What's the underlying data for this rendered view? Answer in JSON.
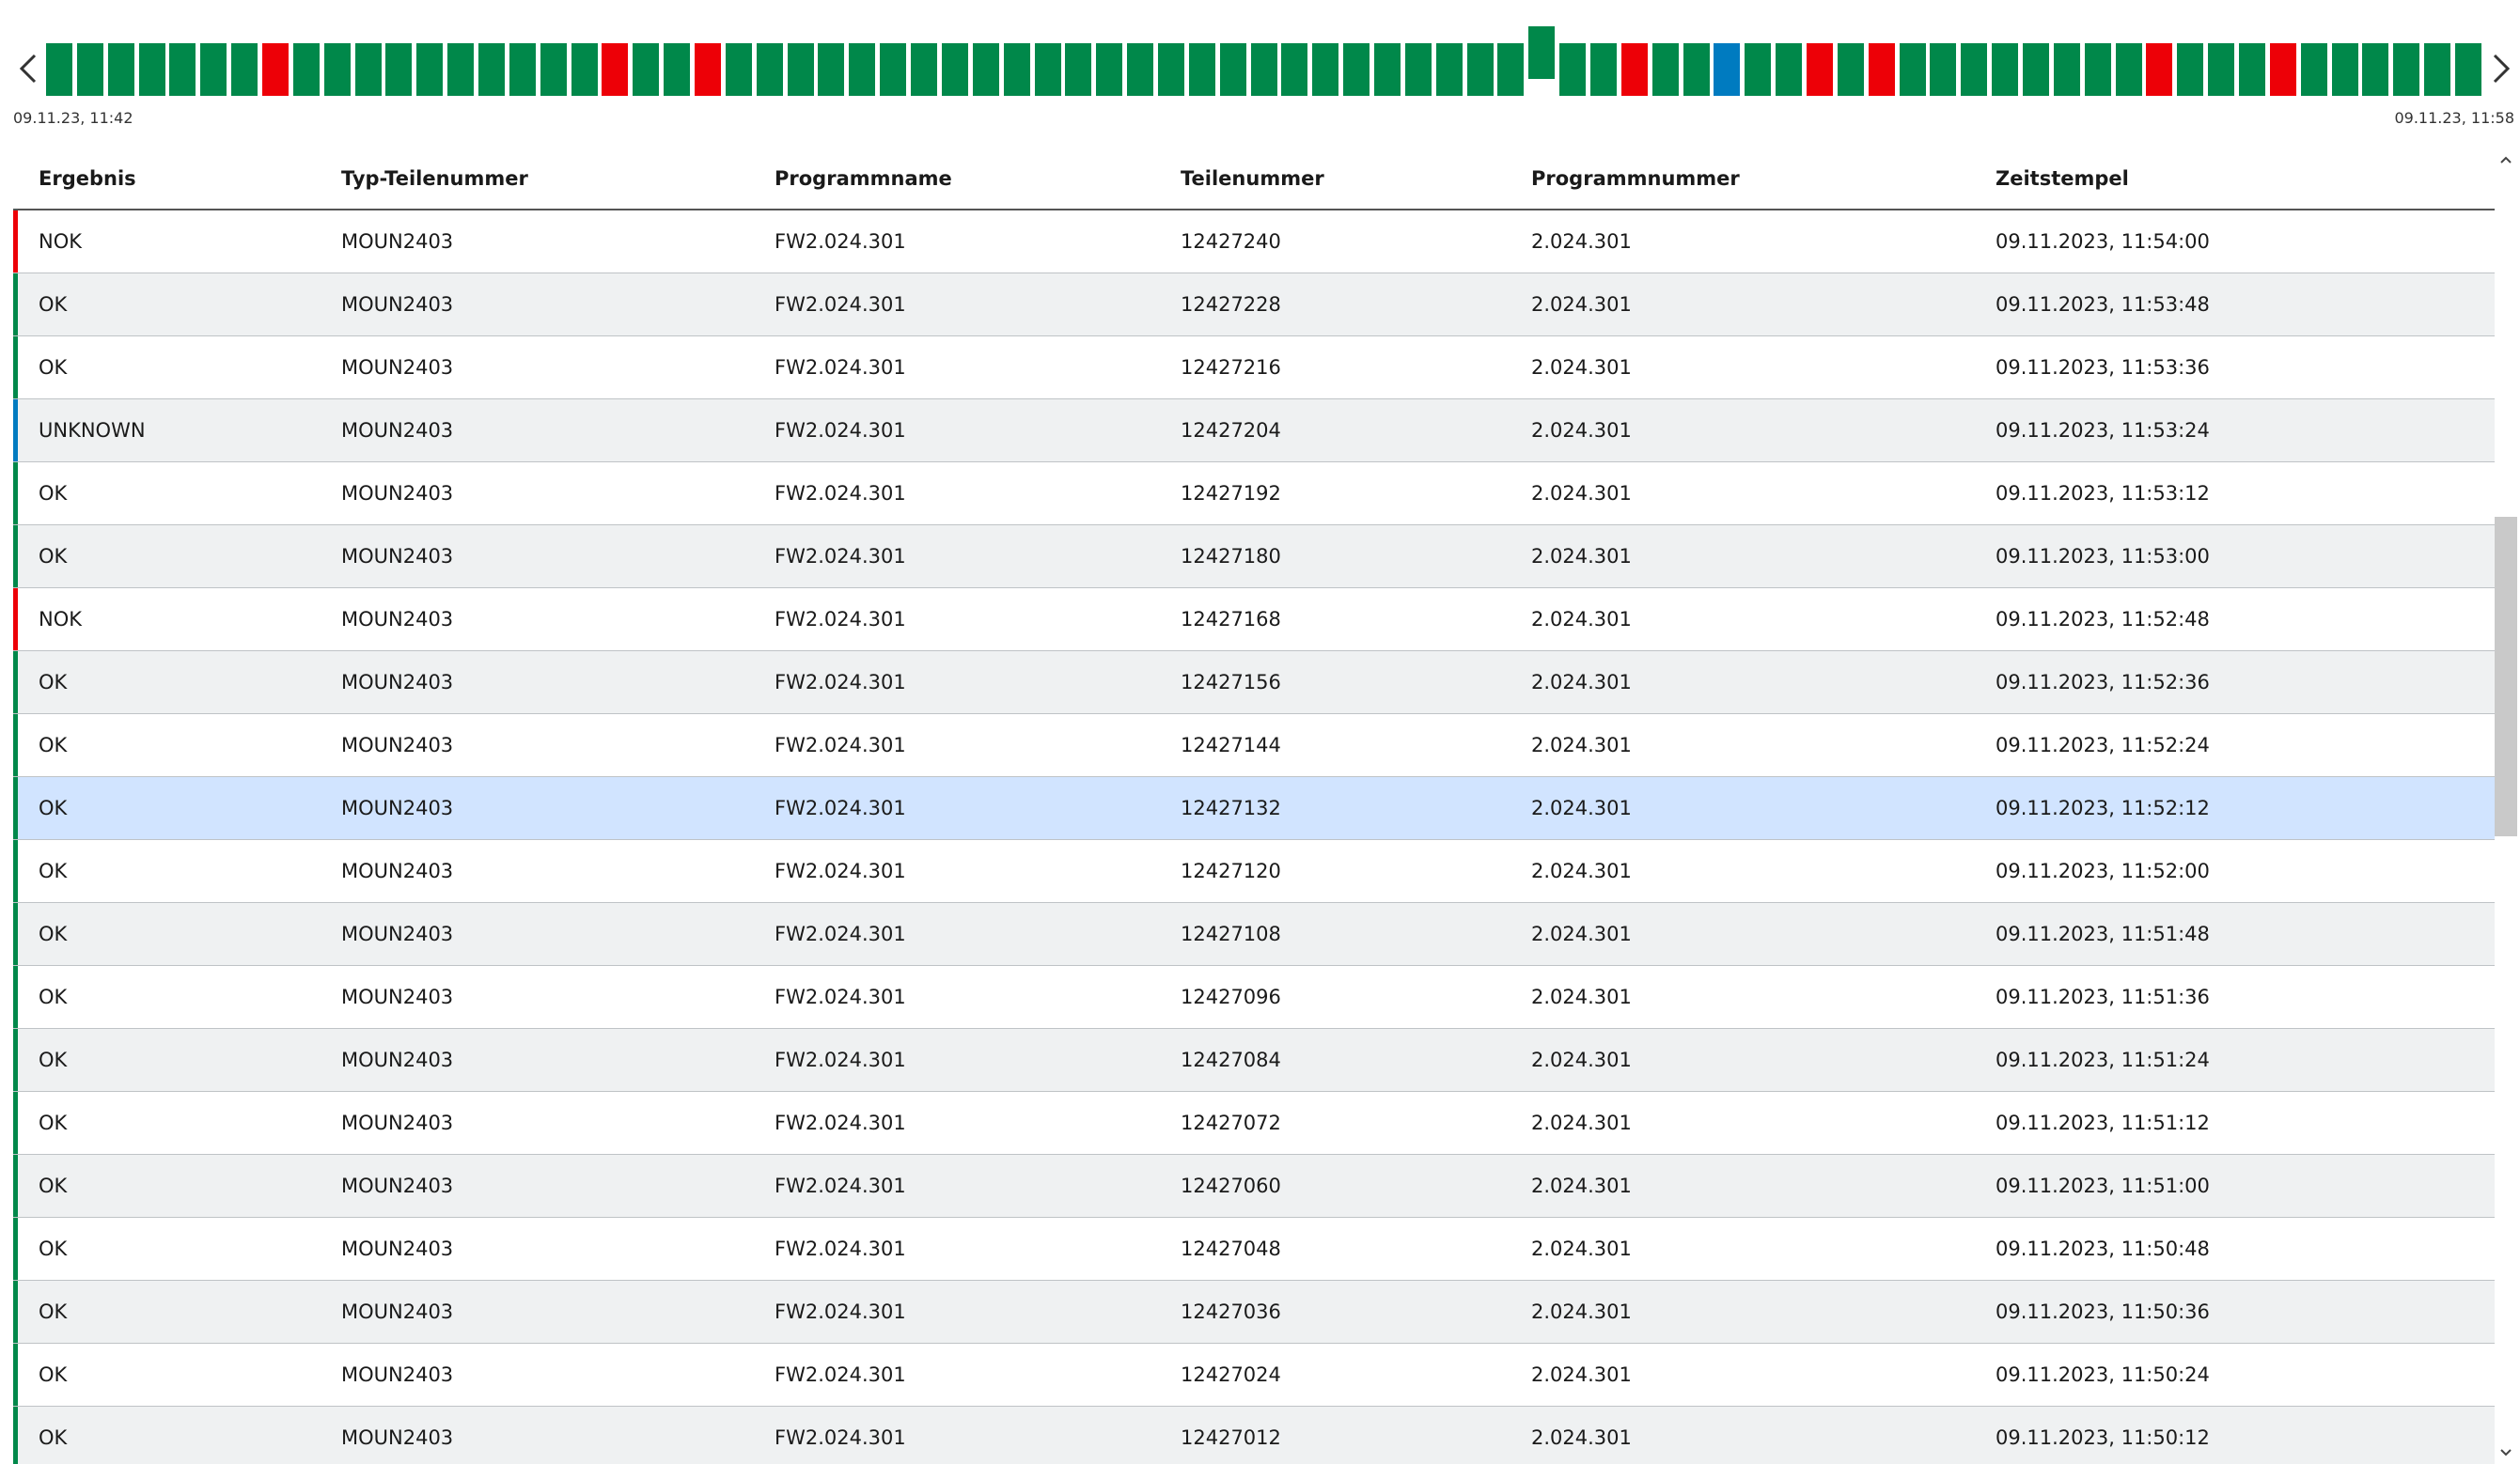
{
  "timeline": {
    "start_time": "09.11.23, 11:42",
    "end_time": "09.11.23, 11:58",
    "prev_icon": "chevron-left-icon",
    "next_icon": "chevron-right-icon",
    "colors": {
      "OK": "#00884a",
      "NOK": "#ed0007",
      "UNKNOWN": "#007bc0"
    },
    "selected_index": 48,
    "bars": [
      "OK",
      "OK",
      "OK",
      "OK",
      "OK",
      "OK",
      "OK",
      "NOK",
      "OK",
      "OK",
      "OK",
      "OK",
      "OK",
      "OK",
      "OK",
      "OK",
      "OK",
      "OK",
      "NOK",
      "OK",
      "OK",
      "NOK",
      "OK",
      "OK",
      "OK",
      "OK",
      "OK",
      "OK",
      "OK",
      "OK",
      "OK",
      "OK",
      "OK",
      "OK",
      "OK",
      "OK",
      "OK",
      "OK",
      "OK",
      "OK",
      "OK",
      "OK",
      "OK",
      "OK",
      "OK",
      "OK",
      "OK",
      "OK",
      "OK",
      "OK",
      "OK",
      "NOK",
      "OK",
      "OK",
      "UNKNOWN",
      "OK",
      "OK",
      "NOK",
      "OK",
      "NOK",
      "OK",
      "OK",
      "OK",
      "OK",
      "OK",
      "OK",
      "OK",
      "OK",
      "NOK",
      "OK",
      "OK",
      "OK",
      "NOK",
      "OK",
      "OK",
      "OK",
      "OK",
      "OK",
      "OK"
    ]
  },
  "table": {
    "headers": {
      "ergebnis": "Ergebnis",
      "typ": "Typ-Teilenummer",
      "programmname": "Programmname",
      "teilenummer": "Teilenummer",
      "programmnummer": "Programmnummer",
      "zeitstempel": "Zeitstempel"
    },
    "selected_row": 9,
    "rows": [
      {
        "ergebnis": "NOK",
        "typ": "MOUN2403",
        "programmname": "FW2.024.301",
        "teilenummer": "12427240",
        "programmnummer": "2.024.301",
        "zeitstempel": "09.11.2023, 11:54:00"
      },
      {
        "ergebnis": "OK",
        "typ": "MOUN2403",
        "programmname": "FW2.024.301",
        "teilenummer": "12427228",
        "programmnummer": "2.024.301",
        "zeitstempel": "09.11.2023, 11:53:48"
      },
      {
        "ergebnis": "OK",
        "typ": "MOUN2403",
        "programmname": "FW2.024.301",
        "teilenummer": "12427216",
        "programmnummer": "2.024.301",
        "zeitstempel": "09.11.2023, 11:53:36"
      },
      {
        "ergebnis": "UNKNOWN",
        "typ": "MOUN2403",
        "programmname": "FW2.024.301",
        "teilenummer": "12427204",
        "programmnummer": "2.024.301",
        "zeitstempel": "09.11.2023, 11:53:24"
      },
      {
        "ergebnis": "OK",
        "typ": "MOUN2403",
        "programmname": "FW2.024.301",
        "teilenummer": "12427192",
        "programmnummer": "2.024.301",
        "zeitstempel": "09.11.2023, 11:53:12"
      },
      {
        "ergebnis": "OK",
        "typ": "MOUN2403",
        "programmname": "FW2.024.301",
        "teilenummer": "12427180",
        "programmnummer": "2.024.301",
        "zeitstempel": "09.11.2023, 11:53:00"
      },
      {
        "ergebnis": "NOK",
        "typ": "MOUN2403",
        "programmname": "FW2.024.301",
        "teilenummer": "12427168",
        "programmnummer": "2.024.301",
        "zeitstempel": "09.11.2023, 11:52:48"
      },
      {
        "ergebnis": "OK",
        "typ": "MOUN2403",
        "programmname": "FW2.024.301",
        "teilenummer": "12427156",
        "programmnummer": "2.024.301",
        "zeitstempel": "09.11.2023, 11:52:36"
      },
      {
        "ergebnis": "OK",
        "typ": "MOUN2403",
        "programmname": "FW2.024.301",
        "teilenummer": "12427144",
        "programmnummer": "2.024.301",
        "zeitstempel": "09.11.2023, 11:52:24"
      },
      {
        "ergebnis": "OK",
        "typ": "MOUN2403",
        "programmname": "FW2.024.301",
        "teilenummer": "12427132",
        "programmnummer": "2.024.301",
        "zeitstempel": "09.11.2023, 11:52:12"
      },
      {
        "ergebnis": "OK",
        "typ": "MOUN2403",
        "programmname": "FW2.024.301",
        "teilenummer": "12427120",
        "programmnummer": "2.024.301",
        "zeitstempel": "09.11.2023, 11:52:00"
      },
      {
        "ergebnis": "OK",
        "typ": "MOUN2403",
        "programmname": "FW2.024.301",
        "teilenummer": "12427108",
        "programmnummer": "2.024.301",
        "zeitstempel": "09.11.2023, 11:51:48"
      },
      {
        "ergebnis": "OK",
        "typ": "MOUN2403",
        "programmname": "FW2.024.301",
        "teilenummer": "12427096",
        "programmnummer": "2.024.301",
        "zeitstempel": "09.11.2023, 11:51:36"
      },
      {
        "ergebnis": "OK",
        "typ": "MOUN2403",
        "programmname": "FW2.024.301",
        "teilenummer": "12427084",
        "programmnummer": "2.024.301",
        "zeitstempel": "09.11.2023, 11:51:24"
      },
      {
        "ergebnis": "OK",
        "typ": "MOUN2403",
        "programmname": "FW2.024.301",
        "teilenummer": "12427072",
        "programmnummer": "2.024.301",
        "zeitstempel": "09.11.2023, 11:51:12"
      },
      {
        "ergebnis": "OK",
        "typ": "MOUN2403",
        "programmname": "FW2.024.301",
        "teilenummer": "12427060",
        "programmnummer": "2.024.301",
        "zeitstempel": "09.11.2023, 11:51:00"
      },
      {
        "ergebnis": "OK",
        "typ": "MOUN2403",
        "programmname": "FW2.024.301",
        "teilenummer": "12427048",
        "programmnummer": "2.024.301",
        "zeitstempel": "09.11.2023, 11:50:48"
      },
      {
        "ergebnis": "OK",
        "typ": "MOUN2403",
        "programmname": "FW2.024.301",
        "teilenummer": "12427036",
        "programmnummer": "2.024.301",
        "zeitstempel": "09.11.2023, 11:50:36"
      },
      {
        "ergebnis": "OK",
        "typ": "MOUN2403",
        "programmname": "FW2.024.301",
        "teilenummer": "12427024",
        "programmnummer": "2.024.301",
        "zeitstempel": "09.11.2023, 11:50:24"
      },
      {
        "ergebnis": "OK",
        "typ": "MOUN2403",
        "programmname": "FW2.024.301",
        "teilenummer": "12427012",
        "programmnummer": "2.024.301",
        "zeitstempel": "09.11.2023, 11:50:12"
      }
    ]
  },
  "scrollbar": {
    "up_icon": "caret-up-icon",
    "down_icon": "caret-down-icon"
  }
}
